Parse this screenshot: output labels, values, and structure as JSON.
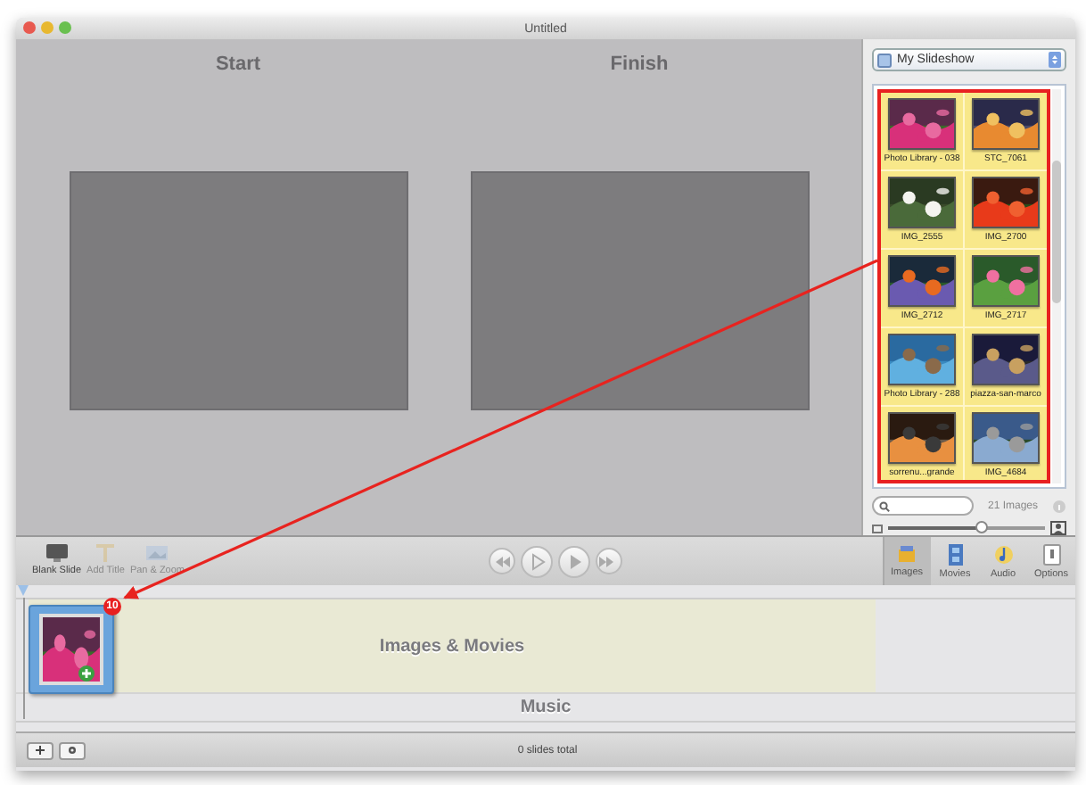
{
  "window": {
    "title": "Untitled"
  },
  "stage": {
    "slides": [
      {
        "label": "Start"
      },
      {
        "label": "Finish"
      }
    ]
  },
  "browser": {
    "source": "My Slideshow",
    "items": [
      {
        "caption": "Photo Library - 038",
        "kind": "picture"
      },
      {
        "caption": "STC_7061",
        "kind": "picture"
      },
      {
        "caption": "IMG_2555",
        "kind": "picture"
      },
      {
        "caption": "IMG_2700",
        "kind": "picture"
      },
      {
        "caption": "IMG_2712",
        "kind": "picture"
      },
      {
        "caption": "IMG_2717",
        "kind": "picture"
      },
      {
        "caption": "Photo Library - 288",
        "kind": "picture"
      },
      {
        "caption": "piazza-san-marco",
        "kind": "picture"
      },
      {
        "caption": "sorrenu...grande",
        "kind": "picture"
      },
      {
        "caption": "IMG_4684",
        "kind": "picture"
      }
    ],
    "count": "21 Images",
    "zoom": {
      "level": 0.6
    }
  },
  "toolbar": {
    "actions": [
      {
        "label": "Blank Slide",
        "disabled": false
      },
      {
        "label": "Add Title",
        "disabled": true
      },
      {
        "label": "Pan & Zoom",
        "disabled": true
      }
    ],
    "media_tabs": [
      {
        "label": "Images",
        "selected": true
      },
      {
        "label": "Movies",
        "selected": false
      },
      {
        "label": "Audio",
        "selected": false
      },
      {
        "label": "Options",
        "selected": false
      }
    ]
  },
  "timeline": {
    "clip": {
      "badge": "10",
      "kind": "picture"
    },
    "tracks": [
      {
        "label": "Images & Movies"
      },
      {
        "label": "Music"
      }
    ]
  },
  "status_bar": {
    "text": "0 slides total"
  }
}
